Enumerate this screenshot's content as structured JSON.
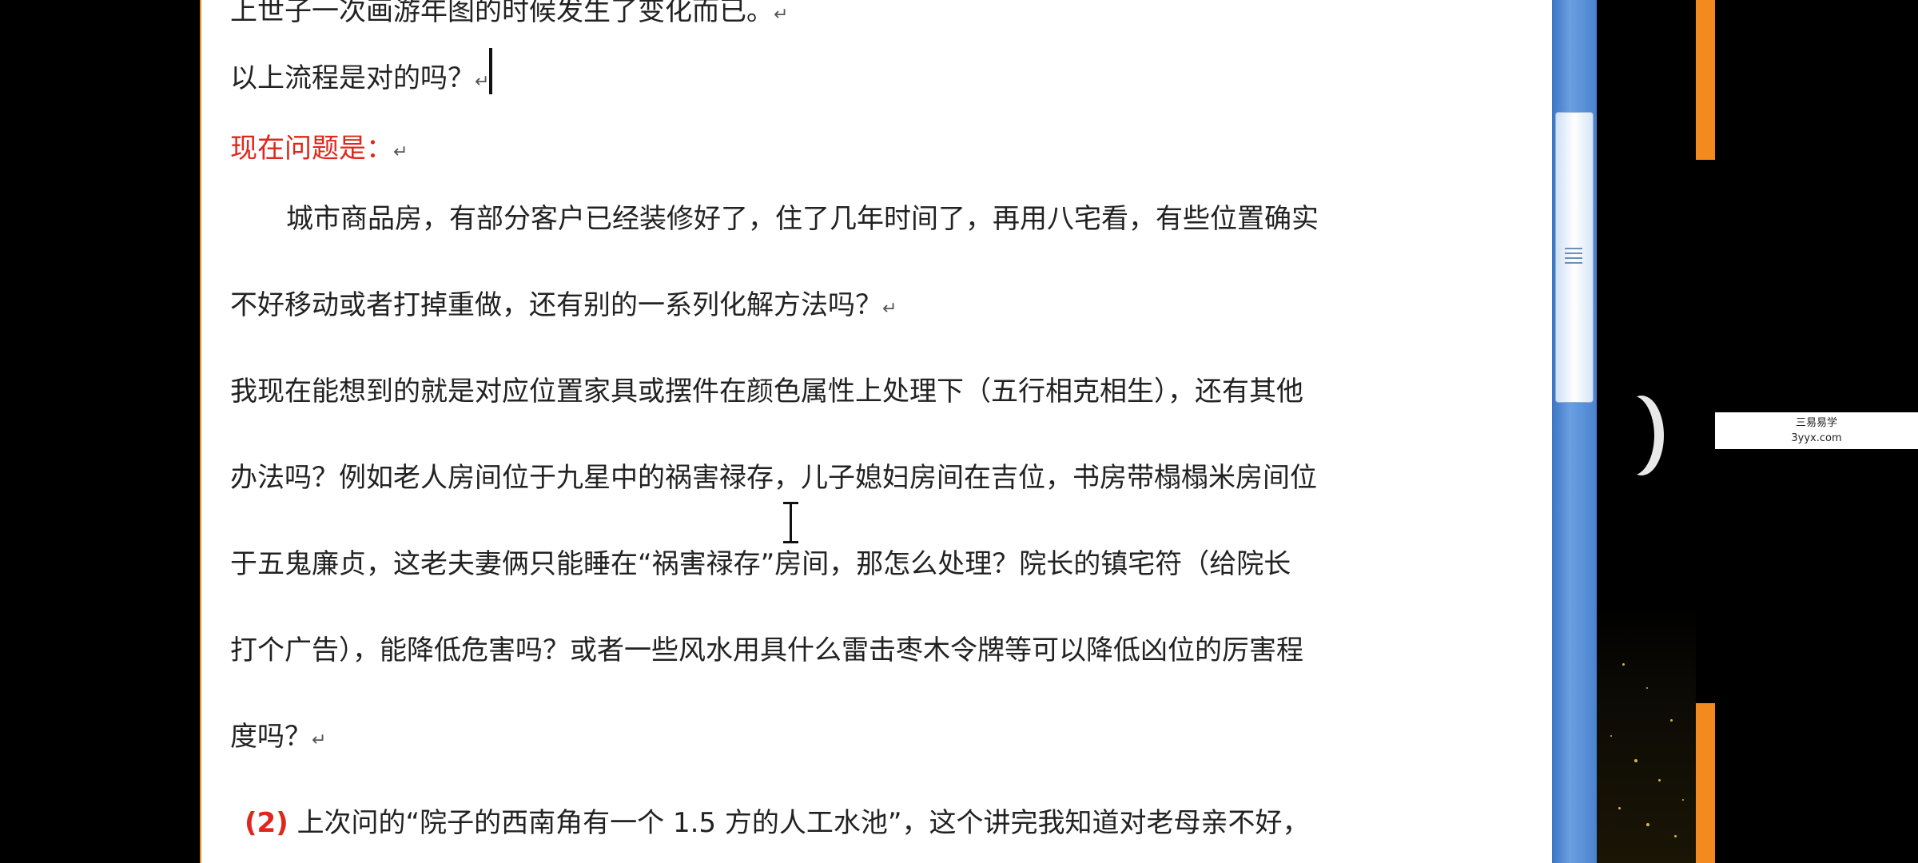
{
  "document": {
    "lines": [
      {
        "text": "上世子一次画游年图的时候发生了变化而已。",
        "mark": "↵"
      },
      {
        "text": "以上流程是对的吗？",
        "mark": "↵"
      },
      {
        "text": "现在问题是：",
        "mark": "↵"
      },
      {
        "text": "城市商品房，有部分客户已经装修好了，住了几年时间了，再用八宅看，有些位置确实"
      },
      {
        "text": "不好移动或者打掉重做，还有别的一系列化解方法吗？",
        "mark": "↵"
      },
      {
        "text": "我现在能想到的就是对应位置家具或摆件在颜色属性上处理下（五行相克相生），还有其他"
      },
      {
        "text": "办法吗？例如老人房间位于九星中的祸害禄存，儿子媳妇房间在吉位，书房带榻榻米房间位"
      },
      {
        "text": "于五鬼廉贞，这老夫妻俩只能睡在“祸害禄存”房间，那怎么处理？院长的镇宅符（给院长"
      },
      {
        "text": "打个广告），能降低危害吗？或者一些风水用具什么雷击枣木令牌等可以降低凶位的厉害程"
      },
      {
        "text": "度吗？",
        "mark": "↵"
      },
      {
        "number": "(2)",
        "text": "上次问的“院子的西南角有一个 1.5 方的人工水池”，这个讲完我知道对老母亲不好，"
      }
    ]
  },
  "watermark": {
    "line1": "三易易学",
    "line2": "3yyx.com"
  },
  "colors": {
    "frame": "#f28a1e",
    "highlight_red": "#e0271d",
    "scrollbar": "#4a82cf"
  },
  "icons": {
    "scroll_grip": "scroll-grip-icon",
    "text_cursor": "ibeam-cursor-icon"
  }
}
